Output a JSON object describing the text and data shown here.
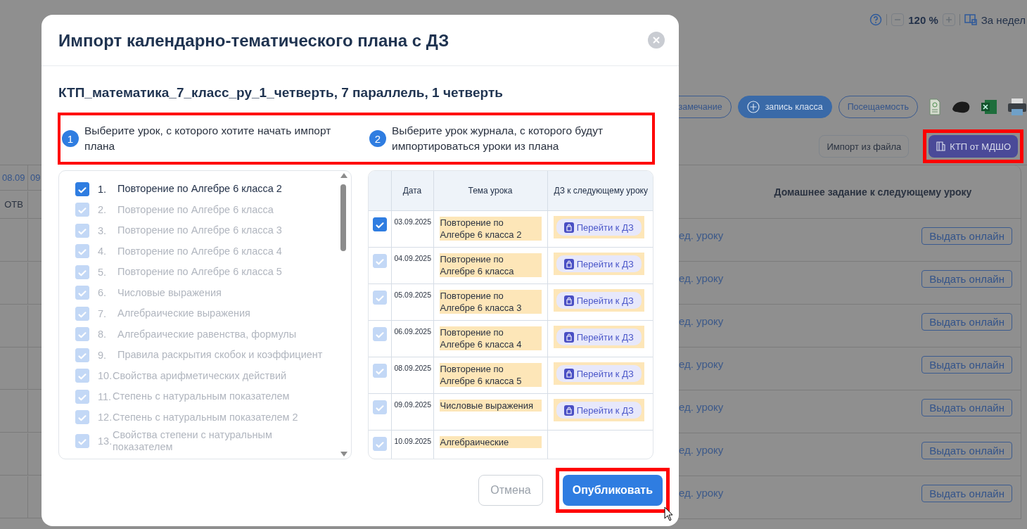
{
  "toolbar": {
    "zoom": "120 %",
    "period": "За недел"
  },
  "actions": [
    {
      "label": "замечание",
      "kind": "outline"
    },
    {
      "label": "запись класса",
      "kind": "filled"
    },
    {
      "label": "Посещаемость",
      "kind": "plain"
    }
  ],
  "import_buttons": [
    {
      "label": "Импорт из файла",
      "kind": "plain",
      "highlighted": false
    },
    {
      "label": "КТП от МДШО",
      "kind": "primary",
      "highlighted": true
    }
  ],
  "journal": {
    "date_columns": [
      "08.09",
      "09"
    ],
    "mark_column": "ОТВ",
    "homework_header": "Домашнее задание к следующему уроку",
    "rows": [
      {
        "text": "ед. уроку",
        "button": "Выдать онлайн"
      },
      {
        "text": "ед. уроку",
        "button": "Выдать онлайн"
      },
      {
        "text": "ед. уроку",
        "button": "Выдать онлайн"
      },
      {
        "text": "ед. уроку",
        "button": "Выдать онлайн"
      },
      {
        "text": "ед. уроку",
        "button": "Выдать онлайн"
      },
      {
        "text": "ед. уроку",
        "button": "Выдать онлайн"
      },
      {
        "text": "ед. уроку",
        "button": "Выдать онлайн"
      }
    ]
  },
  "modal": {
    "title": "Импорт календарно-тематического плана с ДЗ",
    "subtitle": "КТП_математика_7_класс_ру_1_четверть, 7 параллель, 1 четверть",
    "steps_highlighted": true,
    "steps": [
      {
        "number": "1",
        "text": "Выберите урок, с которого хотите начать импорт плана"
      },
      {
        "number": "2",
        "text": "Выберите урок журнала, с которого будут импортироваться уроки из плана"
      }
    ],
    "plan_items": [
      {
        "number": "1.",
        "text": "Повторение по Алгебре 6 класса 2",
        "checked": true,
        "disabled": false
      },
      {
        "number": "2.",
        "text": "Повторение по Алгебре 6 класса",
        "checked": true,
        "disabled": true
      },
      {
        "number": "3.",
        "text": "Повторение по Алгебре 6 класса 3",
        "checked": true,
        "disabled": true
      },
      {
        "number": "4.",
        "text": "Повторение по Алгебре 6 класса 4",
        "checked": true,
        "disabled": true
      },
      {
        "number": "5.",
        "text": "Повторение по Алгебре 6 класса 5",
        "checked": true,
        "disabled": true
      },
      {
        "number": "6.",
        "text": "Числовые выражения",
        "checked": true,
        "disabled": true
      },
      {
        "number": "7.",
        "text": "Алгебраические выражения",
        "checked": true,
        "disabled": true
      },
      {
        "number": "8.",
        "text": "Алгебраические равенства, формулы",
        "checked": true,
        "disabled": true
      },
      {
        "number": "9.",
        "text": "Правила раскрытия скобок и коэффициент",
        "checked": true,
        "disabled": true
      },
      {
        "number": "10.",
        "text": "Свойства арифметических действий",
        "checked": true,
        "disabled": true
      },
      {
        "number": "11.",
        "text": "Степень с натуральным показателем",
        "checked": true,
        "disabled": true
      },
      {
        "number": "12.",
        "text": "Степень с натуральным показателем 2",
        "checked": true,
        "disabled": true
      },
      {
        "number": "13.",
        "text": "Свойства степени с натуральным показателем",
        "checked": true,
        "disabled": true
      }
    ],
    "journal_table": {
      "columns": [
        "Дата",
        "Тема урока",
        "ДЗ к следующему уроку"
      ],
      "rows": [
        {
          "checked": true,
          "disabled": false,
          "date": "03.09.2025",
          "topic": "Повторение по Алгебре 6 класса 2",
          "link": "Перейти к ДЗ"
        },
        {
          "checked": true,
          "disabled": true,
          "date": "04.09.2025",
          "topic": "Повторение по Алгебре 6 класса",
          "link": "Перейти к ДЗ"
        },
        {
          "checked": true,
          "disabled": true,
          "date": "05.09.2025",
          "topic": "Повторение по Алгебре 6 класса 3",
          "link": "Перейти к ДЗ"
        },
        {
          "checked": true,
          "disabled": true,
          "date": "06.09.2025",
          "topic": "Повторение по Алгебре 6 класса 4",
          "link": "Перейти к ДЗ"
        },
        {
          "checked": true,
          "disabled": true,
          "date": "08.09.2025",
          "topic": "Повторение по Алгебре 6 класса 5",
          "link": "Перейти к ДЗ"
        },
        {
          "checked": true,
          "disabled": true,
          "date": "09.09.2025",
          "topic": "Числовые выражения",
          "link": "Перейти к ДЗ"
        },
        {
          "checked": true,
          "disabled": true,
          "date": "10.09.2025",
          "topic": "Алгебраические"
        }
      ]
    },
    "buttons": [
      {
        "label": "Отмена",
        "kind": "secondary",
        "highlighted": false
      },
      {
        "label": "Опубликовать",
        "kind": "primary",
        "highlighted": true
      }
    ]
  }
}
